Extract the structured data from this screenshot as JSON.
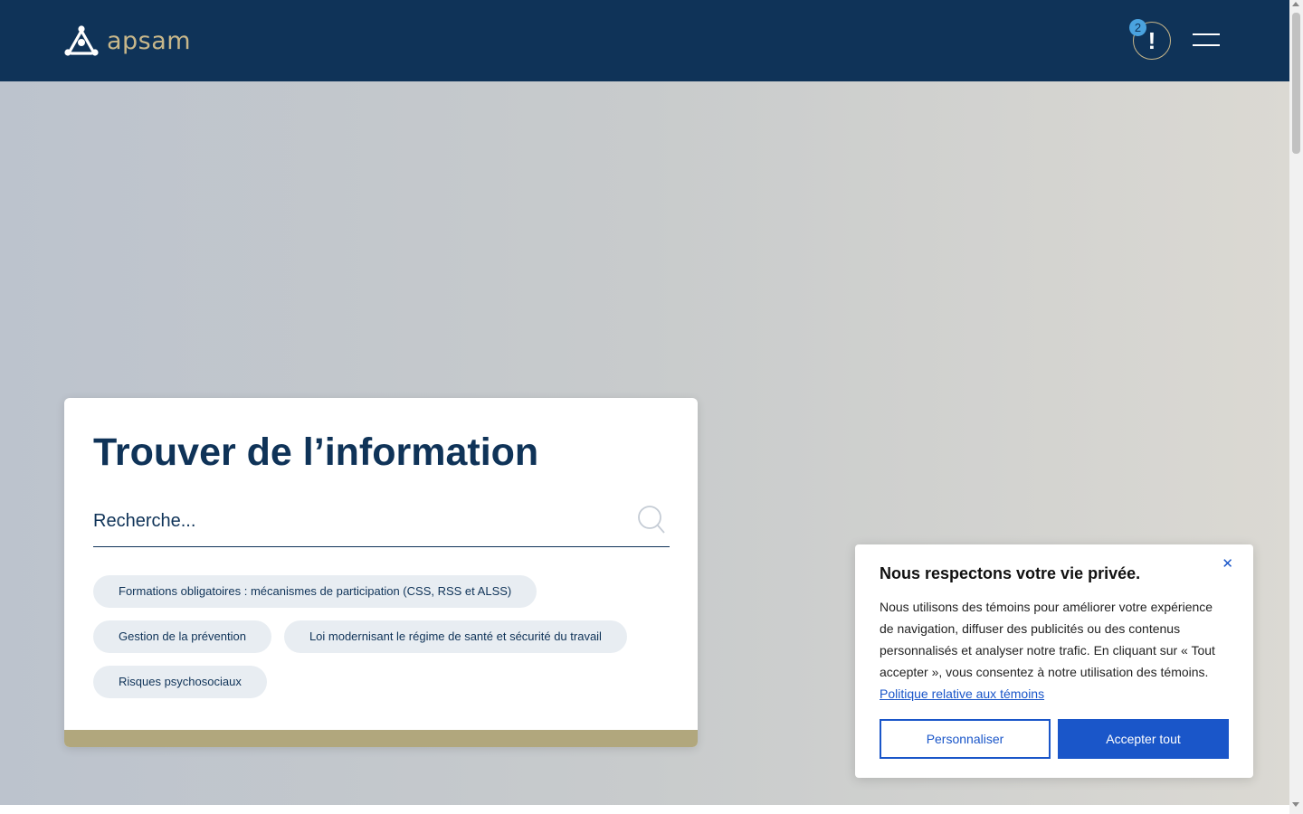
{
  "header": {
    "logo_text": "apsam",
    "alert_count": "2",
    "alert_symbol": "!"
  },
  "search": {
    "title": "Trouver de l’information",
    "placeholder": "Recherche..."
  },
  "chips": [
    [
      "Formations obligatoires : mécanismes de participation (CSS, RSS et ALSS)"
    ],
    [
      "Gestion de la prévention",
      "Loi modernisant le régime de santé et sécurité du travail"
    ],
    [
      "Risques psychosociaux"
    ]
  ],
  "cookie": {
    "title": "Nous respectons votre vie privée.",
    "body": "Nous utilisons des témoins pour améliorer votre expérience de navigation, diffuser des publicités ou des contenus personnalisés et analyser notre trafic. En cliquant sur « Tout accepter », vous consentez à notre utilisation des témoins.",
    "link": "Politique relative aux témoins",
    "customize_label": "Personnaliser",
    "accept_label": "Accepter tout",
    "close_symbol": "✕"
  },
  "colors": {
    "header_bg": "#0f3358",
    "accent_gold": "#c8b78a",
    "primary_blue": "#1a56c9"
  }
}
